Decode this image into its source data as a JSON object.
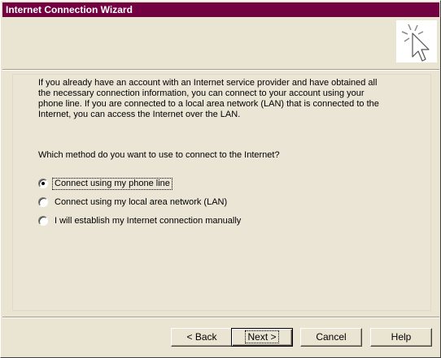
{
  "window": {
    "title": "Internet Connection Wizard",
    "titlebar_color": "#730040",
    "logo_icon": "wizard-cursor-icon"
  },
  "intro_text": "If you already have an account with an Internet service provider and have obtained all the necessary connection information, you can connect to your account using your phone line. If you are connected to a local area network (LAN) that is connected to the Internet, you can access the Internet over the LAN.",
  "question": "Which method do you want to use to connect to the Internet?",
  "options": [
    {
      "label": "Connect using my phone line",
      "selected": true
    },
    {
      "label": "Connect using my local area network (LAN)",
      "selected": false
    },
    {
      "label": "I will establish my Internet connection manually",
      "selected": false
    }
  ],
  "buttons": {
    "back": "< Back",
    "next": "Next >",
    "cancel": "Cancel",
    "help": "Help"
  }
}
